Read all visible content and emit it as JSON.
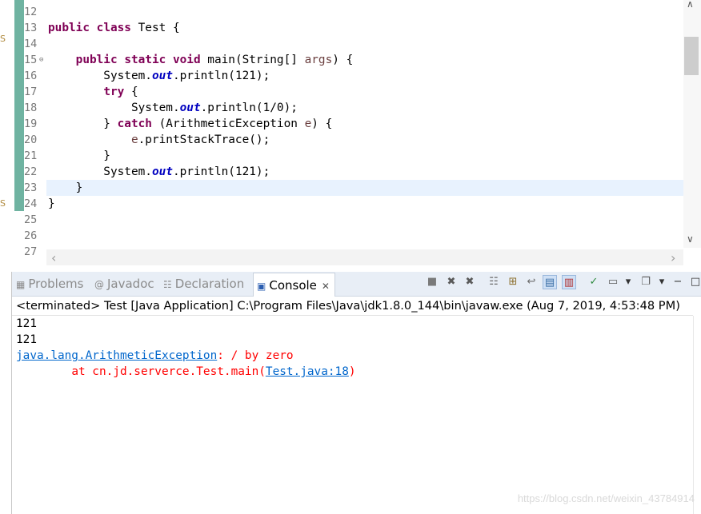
{
  "editor": {
    "lines": [
      {
        "n": "12",
        "code": []
      },
      {
        "n": "13",
        "code": [
          {
            "t": "public",
            "c": "kw"
          },
          {
            "t": " "
          },
          {
            "t": "class",
            "c": "kw"
          },
          {
            "t": " Test {"
          }
        ]
      },
      {
        "n": "14",
        "code": []
      },
      {
        "n": "15",
        "fold": "⊖",
        "code": [
          {
            "t": "    "
          },
          {
            "t": "public",
            "c": "kw"
          },
          {
            "t": " "
          },
          {
            "t": "static",
            "c": "kw"
          },
          {
            "t": " "
          },
          {
            "t": "void",
            "c": "kw"
          },
          {
            "t": " main(String[] "
          },
          {
            "t": "args",
            "c": "var"
          },
          {
            "t": ") {"
          }
        ]
      },
      {
        "n": "16",
        "code": [
          {
            "t": "        System."
          },
          {
            "t": "out",
            "c": "fld"
          },
          {
            "t": ".println(121);"
          }
        ]
      },
      {
        "n": "17",
        "code": [
          {
            "t": "        "
          },
          {
            "t": "try",
            "c": "kw"
          },
          {
            "t": " {"
          }
        ]
      },
      {
        "n": "18",
        "code": [
          {
            "t": "            System."
          },
          {
            "t": "out",
            "c": "fld"
          },
          {
            "t": ".println(1/0);"
          }
        ]
      },
      {
        "n": "19",
        "code": [
          {
            "t": "        } "
          },
          {
            "t": "catch",
            "c": "kw"
          },
          {
            "t": " (ArithmeticException "
          },
          {
            "t": "e",
            "c": "var"
          },
          {
            "t": ") {"
          }
        ]
      },
      {
        "n": "20",
        "code": [
          {
            "t": "            "
          },
          {
            "t": "e",
            "c": "var"
          },
          {
            "t": ".printStackTrace();"
          }
        ]
      },
      {
        "n": "21",
        "code": [
          {
            "t": "        }"
          }
        ]
      },
      {
        "n": "22",
        "code": [
          {
            "t": "        System."
          },
          {
            "t": "out",
            "c": "fld"
          },
          {
            "t": ".println(121);"
          }
        ]
      },
      {
        "n": "23",
        "code": [
          {
            "t": "    }"
          }
        ]
      },
      {
        "n": "24",
        "code": [
          {
            "t": "}"
          }
        ]
      },
      {
        "n": "25",
        "code": []
      },
      {
        "n": "26",
        "code": []
      }
    ],
    "edge_marks": [
      "S",
      "S"
    ]
  },
  "console_view": {
    "tabs": [
      {
        "label": "Problems",
        "icon": "problems-icon",
        "glyph": "▦",
        "active": false
      },
      {
        "label": "Javadoc",
        "icon": "javadoc-icon",
        "glyph": "@",
        "active": false
      },
      {
        "label": "Declaration",
        "icon": "declaration-icon",
        "glyph": "☷",
        "active": false
      },
      {
        "label": "Console",
        "icon": "console-icon",
        "glyph": "▣",
        "active": true,
        "close": "✕"
      }
    ],
    "toolbar": [
      {
        "name": "terminate-icon",
        "glyph": "■"
      },
      {
        "name": "remove-launch-icon",
        "glyph": "✖"
      },
      {
        "name": "remove-all-terminated-icon",
        "glyph": "✖"
      },
      {
        "name": "clear-console-icon",
        "glyph": "☷"
      },
      {
        "name": "scroll-lock-icon",
        "glyph": "⊞"
      },
      {
        "name": "word-wrap-icon",
        "glyph": "↩"
      },
      {
        "name": "show-on-stdout-icon",
        "glyph": "▤",
        "pressed": true
      },
      {
        "name": "show-on-stderr-icon",
        "glyph": "▥",
        "pressed": true
      },
      {
        "name": "pin-console-icon",
        "glyph": "✓"
      },
      {
        "name": "display-console-icon",
        "glyph": "▭"
      },
      {
        "name": "display-console-dropdown-icon",
        "glyph": "▾"
      },
      {
        "name": "open-console-icon",
        "glyph": "❐"
      },
      {
        "name": "open-console-dropdown-icon",
        "glyph": "▾"
      },
      {
        "name": "minimize-icon",
        "glyph": "−"
      },
      {
        "name": "maximize-icon",
        "glyph": "□"
      }
    ],
    "terminated_line": "<terminated> Test [Java Application] C:\\Program Files\\Java\\jdk1.8.0_144\\bin\\javaw.exe (Aug 7, 2019, 4:53:48 PM)",
    "output": [
      [
        {
          "t": "121",
          "c": "std"
        }
      ],
      [
        {
          "t": "121",
          "c": "std"
        }
      ],
      [
        {
          "t": "java.lang.ArithmeticException",
          "c": "lnk"
        },
        {
          "t": ": / by zero",
          "c": "err"
        }
      ],
      [
        {
          "t": "\tat cn.jd.serverce.Test.main(",
          "c": "err"
        },
        {
          "t": "Test.java:18",
          "c": "lnk"
        },
        {
          "t": ")",
          "c": "err"
        }
      ]
    ]
  },
  "scrollbar": {
    "up_arrow": "∧",
    "down_arrow": "∨",
    "left_arrow": "‹",
    "right_arrow": "›"
  },
  "watermark": "https://blog.csdn.net/weixin_43784914"
}
